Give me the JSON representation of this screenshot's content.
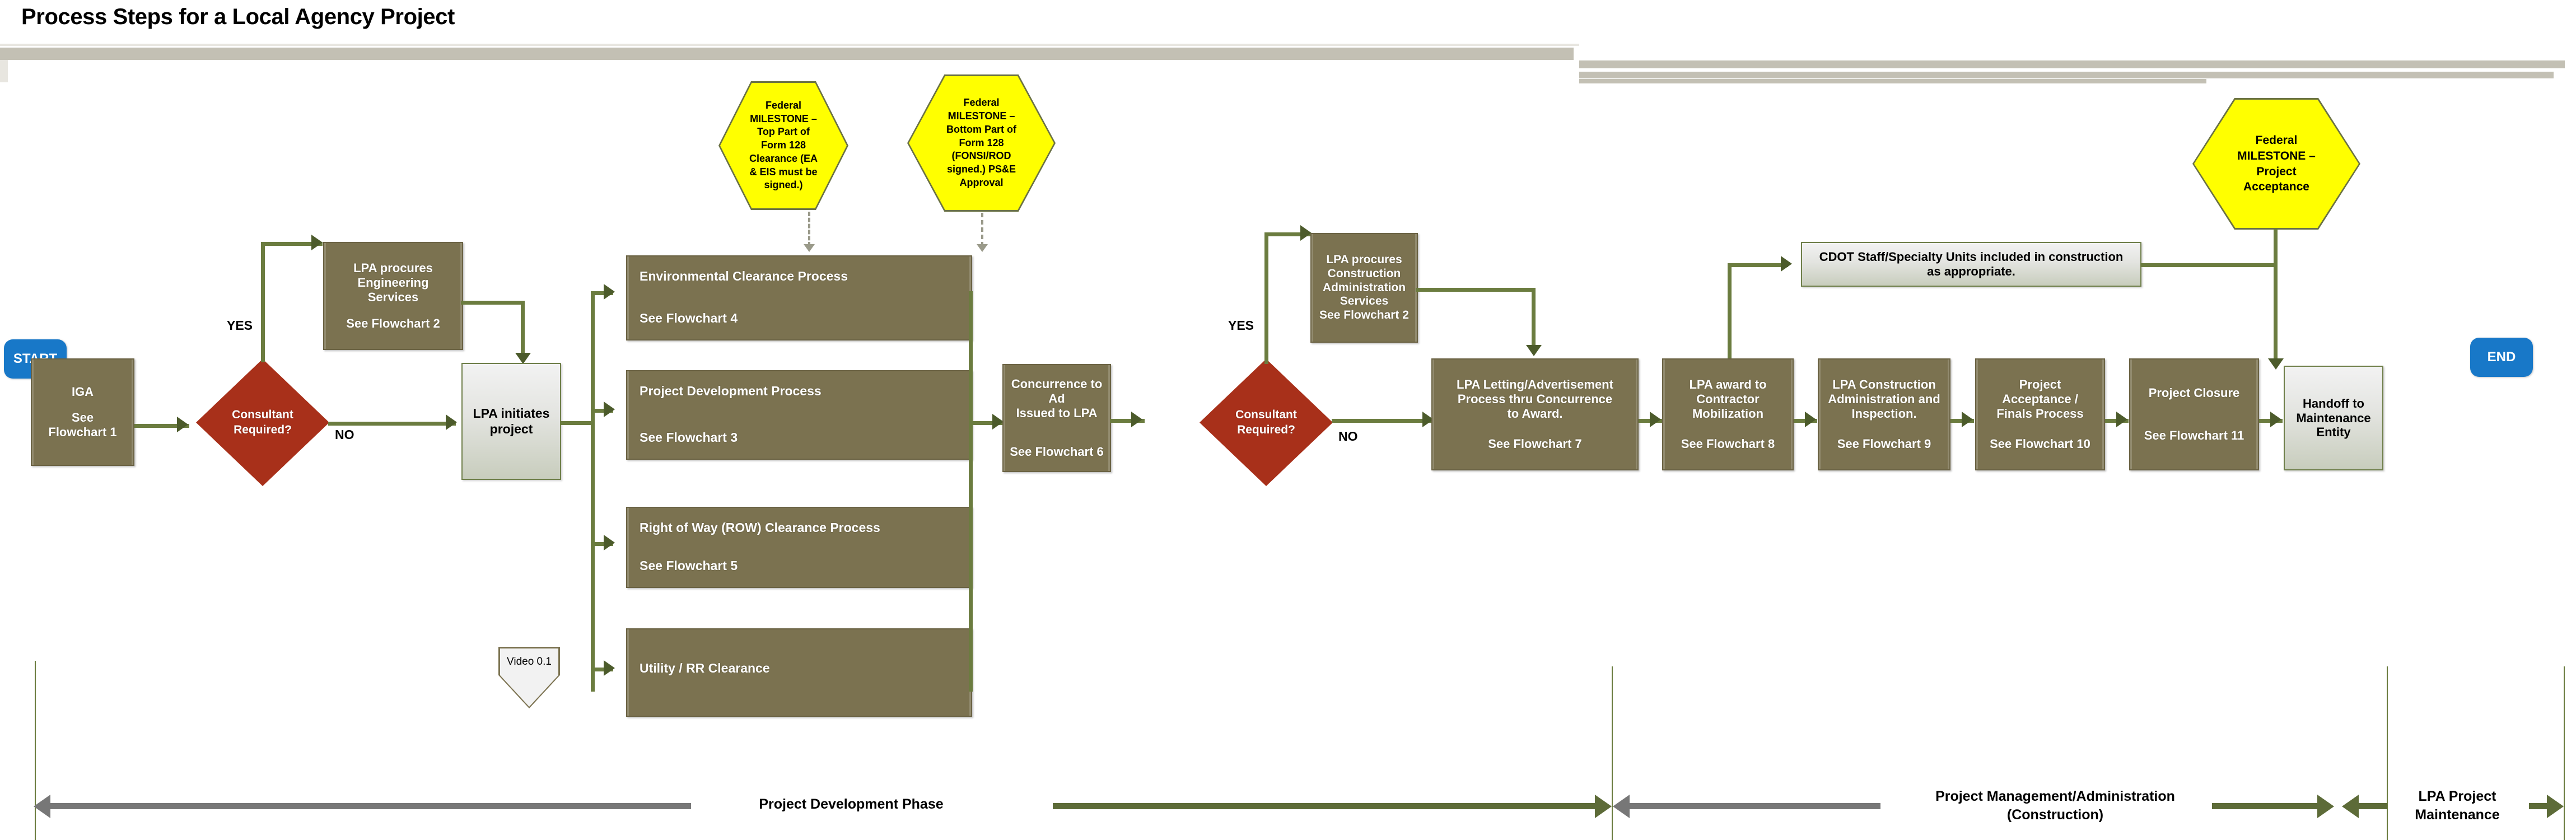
{
  "page_title": "Process Steps for a Local Agency Project",
  "colors": {
    "process_box": "#7b7250",
    "decision_diamond": "#a8301a",
    "milestone_hex": "#ffff00",
    "start_end_pill": "#1878c8",
    "connector_green": "#6b7c3f",
    "header_bar": "#c3c0b4",
    "phase_bar_grey": "#777777",
    "phase_bar_green": "#5d6b38"
  },
  "terminators": {
    "start": "START",
    "end": "END"
  },
  "branch_labels": {
    "yes_1": "YES",
    "no_1": "NO",
    "yes_2": "YES",
    "no_2": "NO"
  },
  "nodes": {
    "iga": {
      "line1": "IGA",
      "line2": "See",
      "line3": "Flowchart 1"
    },
    "consultant_required_1": {
      "line1": "Consultant",
      "line2": "Required?"
    },
    "lpa_procures_engineering": {
      "line1": "LPA procures",
      "line2": "Engineering",
      "line3": "Services",
      "line4": "See Flowchart 2"
    },
    "lpa_initiates_project": {
      "line1": "LPA initiates",
      "line2": "project"
    },
    "environmental_clearance": {
      "title": "Environmental Clearance Process",
      "ref": "See Flowchart 4"
    },
    "project_development": {
      "title": "Project Development Process",
      "ref": "See Flowchart 3"
    },
    "row_clearance": {
      "title": "Right of Way (ROW) Clearance Process",
      "ref": "See Flowchart 5"
    },
    "utility_rr_clearance": {
      "title": "Utility / RR Clearance",
      "ref": ""
    },
    "concurrence_to_ad": {
      "line1": "Concurrence to Ad",
      "line2": "Issued to LPA",
      "ref": "See Flowchart 6"
    },
    "consultant_required_2": {
      "line1": "Consultant",
      "line2": "Required?"
    },
    "lpa_procures_construction_admin": {
      "line1": "LPA procures",
      "line2": "Construction",
      "line3": "Administration",
      "line4": "Services",
      "line5": "See Flowchart 2"
    },
    "lpa_letting": {
      "line1": "LPA Letting/Advertisement",
      "line2": "Process thru Concurrence",
      "line3": "to Award.",
      "ref": "See Flowchart 7"
    },
    "lpa_award": {
      "line1": "LPA award to",
      "line2": "Contractor",
      "line3": "Mobilization",
      "ref": "See Flowchart 8"
    },
    "lpa_construction_admin": {
      "line1": "LPA Construction",
      "line2": "Administration and",
      "line3": "Inspection.",
      "ref": "See Flowchart 9"
    },
    "project_acceptance_finals": {
      "line1": "Project",
      "line2": "Acceptance /",
      "line3": "Finals Process",
      "ref": "See Flowchart 10"
    },
    "project_closure": {
      "line1": "Project Closure",
      "ref": "See Flowchart 11"
    },
    "handoff_maintenance": {
      "line1": "Handoff to",
      "line2": "Maintenance",
      "line3": "Entity"
    },
    "cdot_staff": {
      "line1": "CDOT Staff/Specialty Units included in construction",
      "line2": "as appropriate."
    },
    "video_marker": {
      "label": "Video 0.1"
    }
  },
  "milestones": {
    "form128_top": {
      "lines": [
        "Federal",
        "MILESTONE –",
        "Top Part of",
        "Form 128",
        "Clearance (EA",
        "& EIS must be",
        "signed.)"
      ]
    },
    "form128_bottom": {
      "lines": [
        "Federal",
        "MILESTONE –",
        "Bottom Part of",
        "Form 128",
        "(FONSI/ROD",
        "signed.) PS&E",
        "Approval"
      ]
    },
    "project_acceptance": {
      "lines": [
        "Federal",
        "MILESTONE –",
        "Project",
        "Acceptance"
      ]
    }
  },
  "phases": {
    "project_development": {
      "line1": "Project Development Phase",
      "line2": ""
    },
    "project_management": {
      "line1": "Project Management/Administration",
      "line2": "(Construction)"
    },
    "lpa_maintenance": {
      "line1": "LPA Project",
      "line2": "Maintenance"
    }
  }
}
